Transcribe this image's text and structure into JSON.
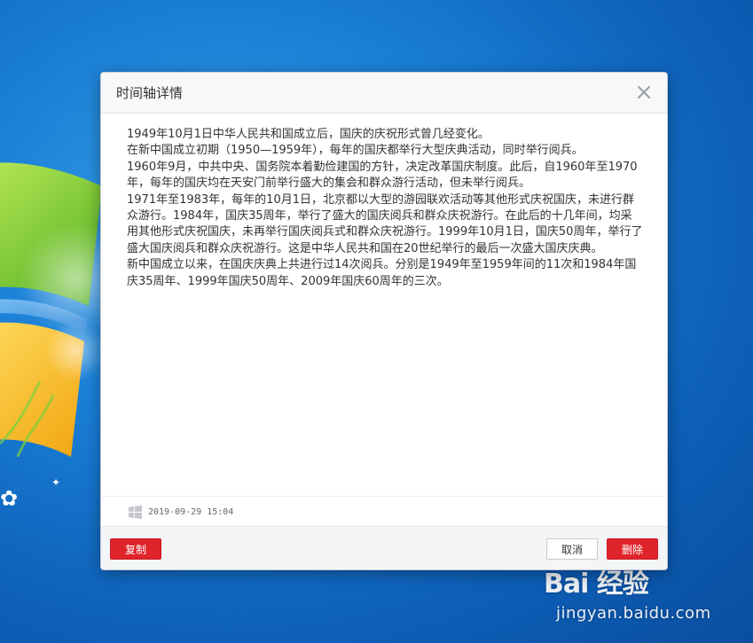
{
  "dialog": {
    "title": "时间轴详情",
    "paragraphs": [
      "1949年10月1日中华人民共和国成立后，国庆的庆祝形式曾几经变化。",
      "在新中国成立初期（1950—1959年），每年的国庆都举行大型庆典活动，同时举行阅兵。",
      "1960年9月，中共中央、国务院本着勤俭建国的方针，决定改革国庆制度。此后，自1960年至1970年，每年的国庆均在天安门前举行盛大的集会和群众游行活动，但未举行阅兵。",
      "1971年至1983年，每年的10月1日，北京都以大型的游园联欢活动等其他形式庆祝国庆，未进行群众游行。1984年，国庆35周年，举行了盛大的国庆阅兵和群众庆祝游行。在此后的十几年间，均采用其他形式庆祝国庆，未再举行国庆阅兵式和群众庆祝游行。1999年10月1日，国庆50周年，举行了盛大国庆阅兵和群众庆祝游行。这是中华人民共和国在20世纪举行的最后一次盛大国庆庆典。",
      "新中国成立以来，在国庆庆典上共进行过14次阅兵。分别是1949年至1959年间的11次和1984年国庆35周年、1999年国庆50周年、2009年国庆60周年的三次。"
    ],
    "timestamp": "2019-09-29 15:04",
    "buttons": {
      "copy": "复制",
      "cancel": "取消",
      "delete": "删除"
    }
  },
  "watermark": {
    "brand": "Bai 经验",
    "url": "jingyan.baidu.com"
  },
  "colors": {
    "accent_red": "#e0242b",
    "desktop_blue": "#1a7fd6"
  },
  "icons": {
    "close": "close-icon",
    "meta": "windows-icon"
  }
}
